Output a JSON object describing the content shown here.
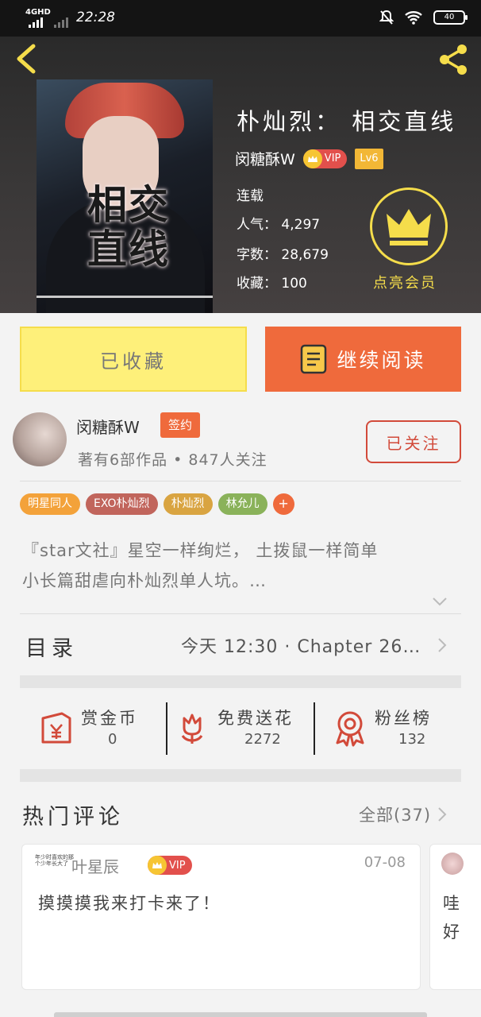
{
  "status_bar": {
    "network": "4GHD",
    "time": "22:28",
    "battery": "40"
  },
  "header": {
    "back_icon": "back-chevron-icon",
    "share_icon": "share-icon"
  },
  "book": {
    "title": "朴灿烈： 相交直线",
    "cover_title_top": "相交",
    "cover_title_bottom": "直线",
    "author": "闵糖酥W",
    "vip_label": "VIP",
    "level": "Lv6",
    "status": "连载",
    "popularity": "人气： 4,297",
    "word_count": "字数： 28,679",
    "favorites": "收藏： 100",
    "member_label": "点亮会员"
  },
  "actions": {
    "collected_label": "已收藏",
    "continue_label": "继续阅读"
  },
  "author_card": {
    "name": "闵糖酥W",
    "badge": "签约",
    "subtitle": "著有6部作品 • 847人关注",
    "follow_label": "已关注"
  },
  "tags": [
    {
      "label": "明星同人",
      "color": "#f3a23a"
    },
    {
      "label": "EXO朴灿烈",
      "color": "#c1655c"
    },
    {
      "label": "朴灿烈",
      "color": "#d9a441"
    },
    {
      "label": "林允儿",
      "color": "#8ab25a"
    }
  ],
  "tag_add_label": "+",
  "intro": {
    "line1": "『star文社』星空一样绚烂， 土拨鼠一样简单",
    "line2": "小长篇甜虐向朴灿烈单人坑。…"
  },
  "toc": {
    "label": "目录",
    "latest": "今天 12:30 · Chapter 26…"
  },
  "support": [
    {
      "label": "赏金币",
      "value": "0",
      "icon": "red-envelope-icon"
    },
    {
      "label": "免费送花",
      "value": "2272",
      "icon": "flower-icon"
    },
    {
      "label": "粉丝榜",
      "value": "132",
      "icon": "ribbon-badge-icon"
    }
  ],
  "comments": {
    "title": "热门评论",
    "all_label": "全部(37)",
    "items": [
      {
        "avatar_text": "年少时喜欢的那个少年长大了",
        "user": "叶星辰",
        "vip": "VIP",
        "date": "07-08",
        "text": "摸摸摸我来打卡来了！"
      }
    ],
    "next_preview": {
      "line1": "哇",
      "line2": "好"
    }
  },
  "colors": {
    "accent": "#ef6a3c",
    "yellow": "#fef07a",
    "crown": "#f5dd4b",
    "follow": "#d24a3a"
  }
}
